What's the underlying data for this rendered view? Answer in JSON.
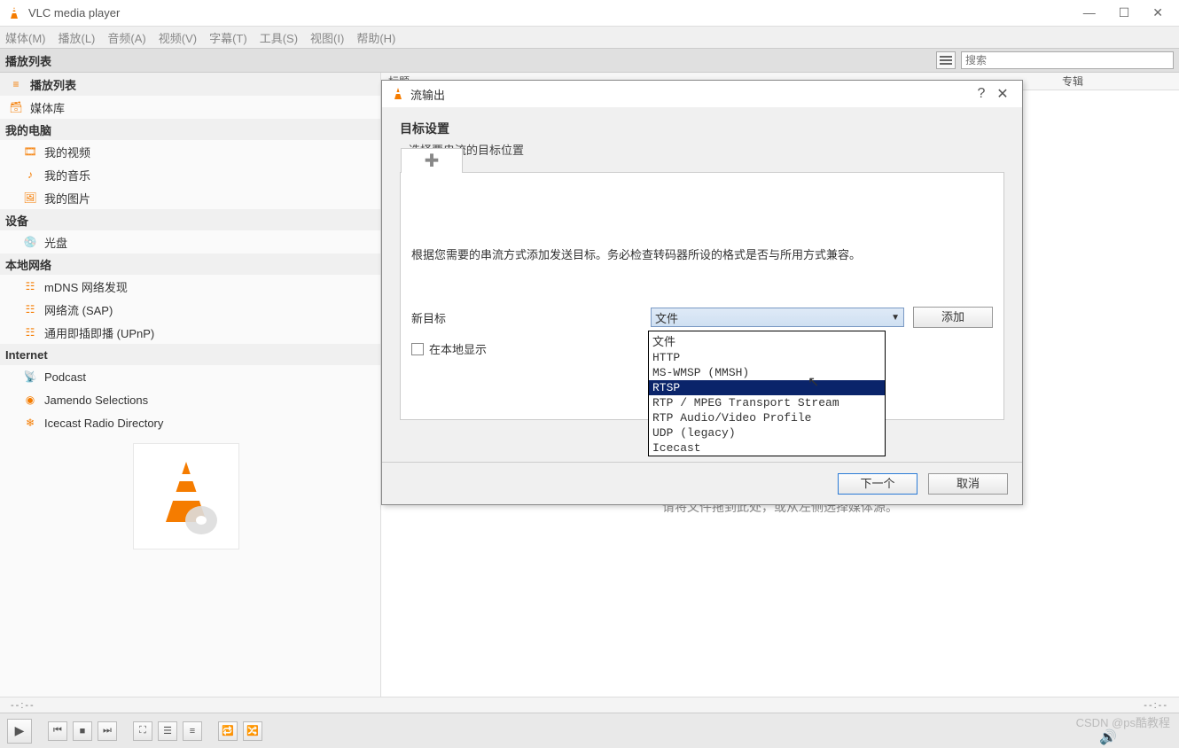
{
  "window": {
    "title": "VLC media player"
  },
  "menu": {
    "items": [
      "媒体(M)",
      "播放(L)",
      "音频(A)",
      "视频(V)",
      "字幕(T)",
      "工具(S)",
      "视图(I)",
      "帮助(H)"
    ]
  },
  "playlist_header": {
    "label": "播放列表"
  },
  "search": {
    "placeholder": "搜索"
  },
  "columns": {
    "title": "标题",
    "album": "专辑"
  },
  "sidebar": {
    "items": [
      {
        "kind": "item",
        "label": "播放列表",
        "icon": "playlist-icon",
        "active": true
      },
      {
        "kind": "item",
        "label": "媒体库",
        "icon": "library-icon"
      },
      {
        "kind": "header",
        "label": "我的电脑"
      },
      {
        "kind": "item",
        "label": "我的视频",
        "icon": "video-icon",
        "indent": true
      },
      {
        "kind": "item",
        "label": "我的音乐",
        "icon": "music-icon",
        "indent": true
      },
      {
        "kind": "item",
        "label": "我的图片",
        "icon": "picture-icon",
        "indent": true
      },
      {
        "kind": "header",
        "label": "设备"
      },
      {
        "kind": "item",
        "label": "光盘",
        "icon": "disc-icon",
        "indent": true
      },
      {
        "kind": "header",
        "label": "本地网络"
      },
      {
        "kind": "item",
        "label": "mDNS 网络发现",
        "icon": "network-icon",
        "indent": true
      },
      {
        "kind": "item",
        "label": "网络流 (SAP)",
        "icon": "network-icon",
        "indent": true
      },
      {
        "kind": "item",
        "label": "通用即插即播  (UPnP)",
        "icon": "network-icon",
        "indent": true
      },
      {
        "kind": "header",
        "label": "Internet"
      },
      {
        "kind": "item",
        "label": "Podcast",
        "icon": "podcast-icon",
        "indent": true
      },
      {
        "kind": "item",
        "label": "Jamendo Selections",
        "icon": "jamendo-icon",
        "indent": true
      },
      {
        "kind": "item",
        "label": "Icecast Radio Directory",
        "icon": "icecast-icon",
        "indent": true
      }
    ]
  },
  "main": {
    "drop_hint": "请将文件拖到此处，或从左侧选择媒体源。"
  },
  "timeline": {
    "left": "--:--",
    "right": "--:--"
  },
  "dialog": {
    "title": "流输出",
    "heading": "目标设置",
    "subheading": "选择要串流的目标位置",
    "description": "根据您需要的串流方式添加发送目标。务必检查转码器所设的格式是否与所用方式兼容。",
    "new_target_label": "新目标",
    "selected_option": "文件",
    "add_button": "添加",
    "local_display_label": "在本地显示",
    "options": [
      "文件",
      "HTTP",
      "MS-WMSP (MMSH)",
      "RTSP",
      "RTP / MPEG Transport Stream",
      "RTP Audio/Video Profile",
      "UDP (legacy)",
      "Icecast"
    ],
    "highlighted_index": 3,
    "next": "下一个",
    "cancel": "取消"
  },
  "watermark": "CSDN @ps酷教程"
}
